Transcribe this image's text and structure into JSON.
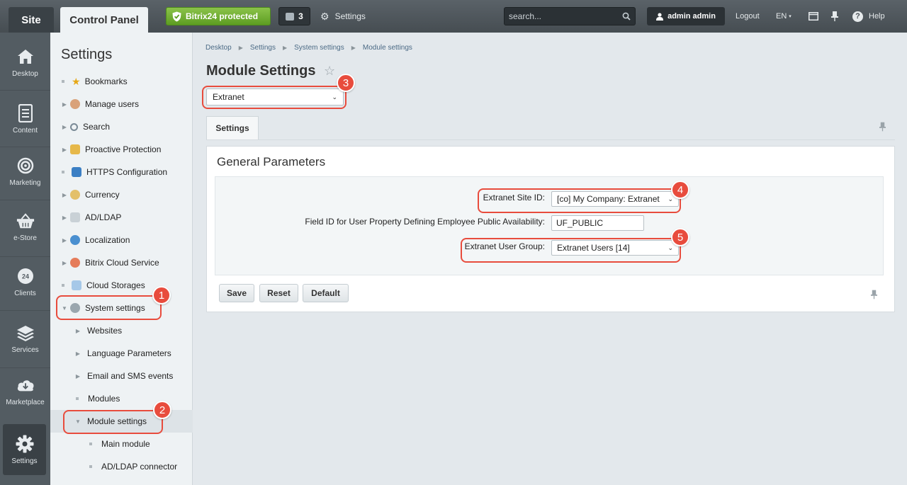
{
  "topbar": {
    "site_tab": "Site",
    "control_panel_tab": "Control Panel",
    "protected_label": "Bitrix24 protected",
    "notifications_count": "3",
    "settings_label": "Settings",
    "search_placeholder": "search...",
    "user_label": "admin admin",
    "logout_label": "Logout",
    "lang_label": "EN",
    "help_label": "Help"
  },
  "rail": {
    "items": [
      {
        "label": "Desktop",
        "icon": "home-icon"
      },
      {
        "label": "Content",
        "icon": "document-icon"
      },
      {
        "label": "Marketing",
        "icon": "target-icon"
      },
      {
        "label": "e-Store",
        "icon": "basket-icon"
      },
      {
        "label": "Clients",
        "icon": "clients-icon"
      },
      {
        "label": "Services",
        "icon": "layers-icon"
      },
      {
        "label": "Marketplace",
        "icon": "cloud-download-icon"
      },
      {
        "label": "Settings",
        "icon": "gear-icon"
      }
    ]
  },
  "menu": {
    "title": "Settings",
    "items": [
      {
        "label": "Bookmarks"
      },
      {
        "label": "Manage users"
      },
      {
        "label": "Search"
      },
      {
        "label": "Proactive Protection"
      },
      {
        "label": "HTTPS Configuration"
      },
      {
        "label": "Currency"
      },
      {
        "label": "AD/LDAP"
      },
      {
        "label": "Localization"
      },
      {
        "label": "Bitrix Cloud Service"
      },
      {
        "label": "Cloud Storages"
      },
      {
        "label": "System settings"
      },
      {
        "label": "Websites"
      },
      {
        "label": "Language Parameters"
      },
      {
        "label": "Email and SMS events"
      },
      {
        "label": "Modules"
      },
      {
        "label": "Module settings"
      },
      {
        "label": "Main module"
      },
      {
        "label": "AD/LDAP connector"
      }
    ]
  },
  "breadcrumb": [
    "Desktop",
    "Settings",
    "System settings",
    "Module settings"
  ],
  "page": {
    "title": "Module Settings",
    "module_selected": "Extranet",
    "tab_label": "Settings",
    "section_title": "General Parameters"
  },
  "form": {
    "site_id_label": "Extranet Site ID:",
    "site_id_value": "[co] My Company: Extranet",
    "field_id_label": "Field ID for User Property Defining Employee Public Availability:",
    "field_id_value": "UF_PUBLIC",
    "user_group_label": "Extranet User Group:",
    "user_group_value": "Extranet Users [14]"
  },
  "buttons": {
    "save": "Save",
    "reset": "Reset",
    "default": "Default"
  },
  "annotations": [
    "1",
    "2",
    "3",
    "4",
    "5"
  ],
  "colors": {
    "highlight": "#e84c3d",
    "protected_green": "#5d9d22",
    "rail_bg": "#535c62"
  }
}
